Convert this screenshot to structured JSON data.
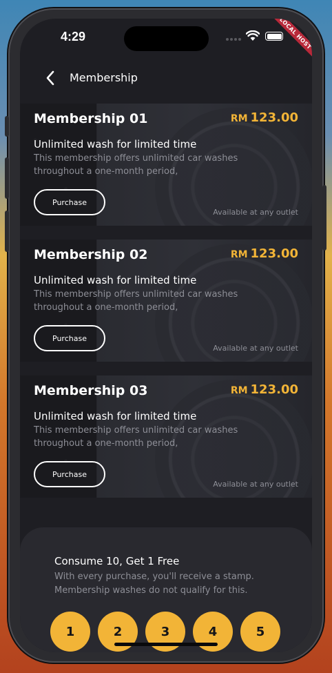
{
  "status_bar": {
    "time": "4:29",
    "debug_banner": "LOCAL HOST"
  },
  "header": {
    "title": "Membership",
    "back_icon": "chevron-left-icon"
  },
  "cards": [
    {
      "name": "Membership 01",
      "currency": "RM",
      "price": "123.00",
      "subtitle": "Unlimited wash for limited time",
      "description": "This membership offers unlimited car washes throughout a one-month period,",
      "button_label": "Purchase",
      "availability": "Available at any outlet"
    },
    {
      "name": "Membership 02",
      "currency": "RM",
      "price": "123.00",
      "subtitle": "Unlimited wash for limited time",
      "description": "This membership offers unlimited car washes throughout a one-month period,",
      "button_label": "Purchase",
      "availability": "Available at any outlet"
    },
    {
      "name": "Membership 03",
      "currency": "RM",
      "price": "123.00",
      "subtitle": "Unlimited wash for limited time",
      "description": "This membership offers unlimited car washes throughout a one-month period,",
      "button_label": "Purchase",
      "availability": "Available at any outlet"
    }
  ],
  "stamp_panel": {
    "title": "Consume 10, Get 1 Free",
    "description_line1": "With every purchase, you'll receive a stamp.",
    "description_line2": "Membership washes do not qualify for this.",
    "stamps": [
      "1",
      "2",
      "3",
      "4",
      "5"
    ]
  },
  "colors": {
    "accent": "#f2b437",
    "background": "#1e1e23",
    "panel": "#29292f",
    "muted_text": "#8e8f97",
    "banner": "#b8293a"
  }
}
